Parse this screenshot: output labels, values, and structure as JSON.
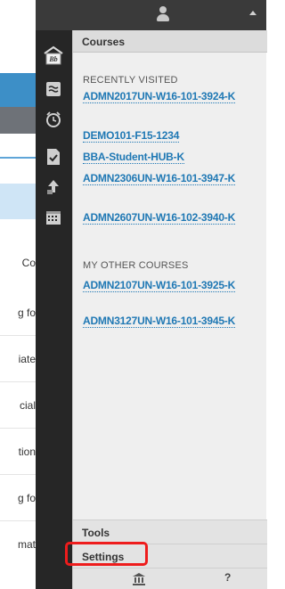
{
  "top_bar": {
    "user_icon": "user-icon",
    "caret_icon": "caret-up-icon"
  },
  "background_page": {
    "fragments": [
      "Co",
      "g fo",
      "iate",
      "cial",
      "tion",
      "g fo",
      "mat"
    ]
  },
  "rail": {
    "icons": [
      "blackboard-home-icon",
      "activity-stream-icon",
      "calendar-alarm-icon",
      "grades-icon",
      "messages-icon",
      "calendar-icon"
    ]
  },
  "panel": {
    "header": "Courses",
    "recently_visited_label": "RECENTLY VISITED",
    "recently_visited": [
      "ADMN2017UN-W16-101-3924-K",
      "DEMO101-F15-1234",
      "BBA-Student-HUB-K",
      "ADMN2306UN-W16-101-3947-K",
      "ADMN2607UN-W16-102-3940-K"
    ],
    "other_courses_label": "MY OTHER COURSES",
    "other_courses": [
      "ADMN2107UN-W16-101-3925-K",
      "ADMN3127UN-W16-101-3945-K"
    ],
    "tools_label": "Tools",
    "settings_label": "Settings",
    "footer": {
      "institution_icon": "institution-icon",
      "help_label": "?"
    }
  },
  "colors": {
    "link": "#1f78b4",
    "rail": "#262626",
    "highlight": "#ee1c1c"
  }
}
